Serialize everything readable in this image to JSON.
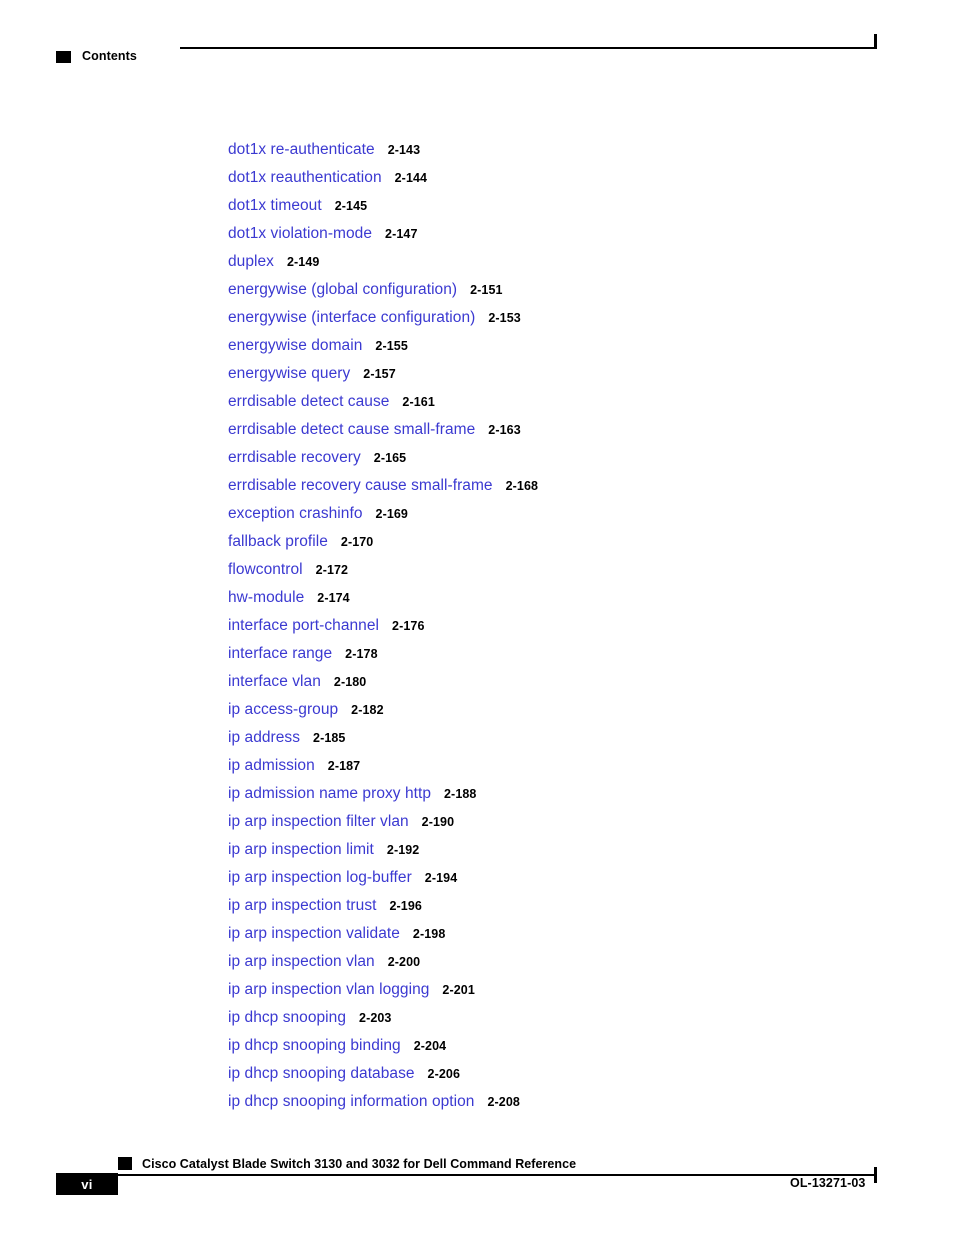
{
  "document": {
    "header_section": "Contents",
    "footer_title": "Cisco Catalyst Blade Switch 3130 and 3032 for Dell Command Reference",
    "footer_page_number": "vi",
    "footer_doc_id": "OL-13271-03",
    "link_color": "#3b39d1",
    "text_color": "#000000"
  },
  "toc": {
    "entries": [
      {
        "label": "dot1x re-authenticate",
        "page": "2-143"
      },
      {
        "label": "dot1x reauthentication",
        "page": "2-144"
      },
      {
        "label": "dot1x timeout",
        "page": "2-145"
      },
      {
        "label": "dot1x violation-mode",
        "page": "2-147"
      },
      {
        "label": "duplex",
        "page": "2-149"
      },
      {
        "label": "energywise (global configuration)",
        "page": "2-151"
      },
      {
        "label": "energywise (interface configuration)",
        "page": "2-153"
      },
      {
        "label": "energywise domain",
        "page": "2-155"
      },
      {
        "label": "energywise query",
        "page": "2-157"
      },
      {
        "label": "errdisable detect cause",
        "page": "2-161"
      },
      {
        "label": "errdisable detect cause small-frame",
        "page": "2-163"
      },
      {
        "label": "errdisable recovery",
        "page": "2-165"
      },
      {
        "label": "errdisable recovery cause small-frame",
        "page": "2-168"
      },
      {
        "label": "exception crashinfo",
        "page": "2-169"
      },
      {
        "label": "fallback profile",
        "page": "2-170"
      },
      {
        "label": "flowcontrol",
        "page": "2-172"
      },
      {
        "label": "hw-module",
        "page": "2-174"
      },
      {
        "label": "interface port-channel",
        "page": "2-176"
      },
      {
        "label": "interface range",
        "page": "2-178"
      },
      {
        "label": "interface vlan",
        "page": "2-180"
      },
      {
        "label": "ip access-group",
        "page": "2-182"
      },
      {
        "label": "ip address",
        "page": "2-185"
      },
      {
        "label": "ip admission",
        "page": "2-187"
      },
      {
        "label": "ip admission name proxy http",
        "page": "2-188"
      },
      {
        "label": "ip arp inspection filter vlan",
        "page": "2-190"
      },
      {
        "label": "ip arp inspection limit",
        "page": "2-192"
      },
      {
        "label": "ip arp inspection log-buffer",
        "page": "2-194"
      },
      {
        "label": "ip arp inspection trust",
        "page": "2-196"
      },
      {
        "label": "ip arp inspection validate",
        "page": "2-198"
      },
      {
        "label": "ip arp inspection vlan",
        "page": "2-200"
      },
      {
        "label": "ip arp inspection vlan logging",
        "page": "2-201"
      },
      {
        "label": "ip dhcp snooping",
        "page": "2-203"
      },
      {
        "label": "ip dhcp snooping binding",
        "page": "2-204"
      },
      {
        "label": "ip dhcp snooping database",
        "page": "2-206"
      },
      {
        "label": "ip dhcp snooping information option",
        "page": "2-208"
      }
    ]
  }
}
